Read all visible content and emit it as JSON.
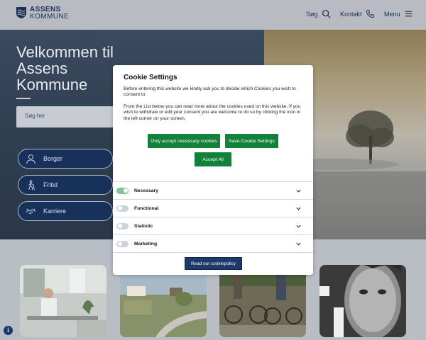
{
  "header": {
    "logo_line1": "ASSENS",
    "logo_line2": "KOMMUNE",
    "search_label": "Søg",
    "contact_label": "Kontakt",
    "menu_label": "Menu",
    "icons": [
      "search-icon",
      "phone-icon",
      "hamburger-icon"
    ]
  },
  "hero": {
    "title": "Velkommen til Assens Kommune",
    "search_placeholder": "Søg her",
    "categories": [
      {
        "label": "Borger",
        "icon": "person-icon"
      },
      {
        "label": "Fritid",
        "icon": "hiking-icon"
      },
      {
        "label": "Karriere",
        "icon": "handshake-icon"
      }
    ]
  },
  "cookie_modal": {
    "title": "Cookie Settings",
    "intro": "Before entering this website we kindly ask you to decide which Cookies you wish to consent to.",
    "details": "From the List below you can read more about the cookies used on this website. If you wish to withdraw or edit your consent you are welcome to do so by clicking the icon in the left corner on your screen.",
    "btn_necessary": "Only accept necessary cookies",
    "btn_save": "Save Cookie Settings",
    "btn_accept_all": "Accept All",
    "categories": [
      {
        "label": "Necessary",
        "enabled": true
      },
      {
        "label": "Functional",
        "enabled": false
      },
      {
        "label": "Statistic",
        "enabled": false
      },
      {
        "label": "Marketing",
        "enabled": false
      }
    ],
    "read_policy": "Read our cookiepolicy"
  },
  "colors": {
    "brand_navy": "#1b3a6b",
    "accept_green": "#12813a",
    "toggle_on": "#7fc59a"
  },
  "floating": {
    "info_icon_glyph": "i"
  }
}
